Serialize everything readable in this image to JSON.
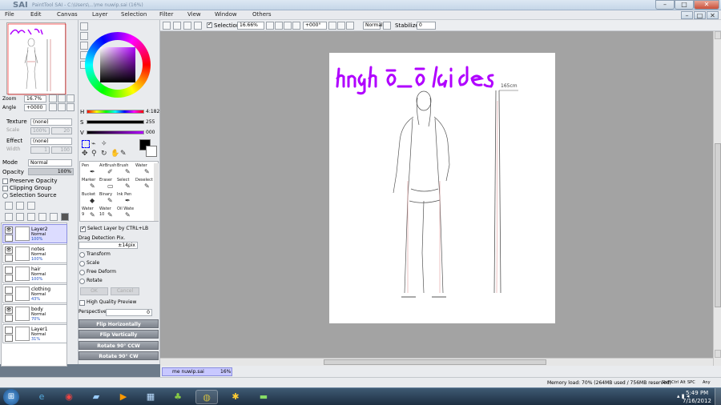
{
  "window": {
    "app_logo": "SAI",
    "title_path": "PaintTool SAI - C:\\Users\\...\\me nuwip.sai (16%)"
  },
  "menu": [
    "File",
    "Edit",
    "Canvas",
    "Layer",
    "Selection",
    "Filter",
    "View",
    "Window",
    "Others"
  ],
  "toolbar": {
    "selection_label": "Selection",
    "zoom_value": "16.66%",
    "angle_value": "+000°",
    "mode_value": "Normal",
    "stabilizer_label": "Stabilizer",
    "stabilizer_value": "0"
  },
  "navigator": {
    "zoom_label": "Zoom",
    "zoom_value": "16.7%",
    "angle_label": "Angle",
    "angle_value": "+0000"
  },
  "color": {
    "h_label": "H",
    "h_value": "4:182",
    "s_label": "S",
    "s_value": "255",
    "v_label": "V",
    "v_value": "000",
    "primary": "#000000",
    "accent": "#b000ff"
  },
  "texture": {
    "texture_label": "Texture",
    "texture_value": "(none)",
    "scale_label": "Scale",
    "scale_value": "100%",
    "scale_num": "20",
    "effect_label": "Effect",
    "effect_value": "(none)",
    "width_label": "Width",
    "width_value": "1",
    "width_num": "100"
  },
  "layer_props": {
    "mode_label": "Mode",
    "mode_value": "Normal",
    "opacity_label": "Opacity",
    "opacity_value": "100%",
    "preserve_opacity": "Preserve Opacity",
    "clipping_group": "Clipping Group",
    "selection_source": "Selection Source"
  },
  "layers": [
    {
      "name": "Layer2",
      "mode": "Normal",
      "opacity": "100%",
      "visible": true,
      "selected": true
    },
    {
      "name": "notes",
      "mode": "Normal",
      "opacity": "100%",
      "visible": true,
      "selected": false
    },
    {
      "name": "hair",
      "mode": "Normal",
      "opacity": "100%",
      "visible": false,
      "selected": false
    },
    {
      "name": "clothing",
      "mode": "Normal",
      "opacity": "43%",
      "visible": false,
      "selected": false
    },
    {
      "name": "body",
      "mode": "Normal",
      "opacity": "70%",
      "visible": true,
      "selected": false
    },
    {
      "name": "Layer1",
      "mode": "Normal",
      "opacity": "31%",
      "visible": false,
      "selected": false
    }
  ],
  "tools": [
    {
      "label": "Pen",
      "size": ""
    },
    {
      "label": "AirBrush",
      "size": ""
    },
    {
      "label": "Brush",
      "size": ""
    },
    {
      "label": "Water",
      "size": ""
    },
    {
      "label": "Marker",
      "size": ""
    },
    {
      "label": "Eraser",
      "size": ""
    },
    {
      "label": "Select",
      "size": ""
    },
    {
      "label": "Deselect",
      "size": ""
    },
    {
      "label": "Bucket",
      "size": ""
    },
    {
      "label": "Binary",
      "size": ""
    },
    {
      "label": "Ink Pen",
      "size": ""
    },
    {
      "label": "",
      "size": ""
    },
    {
      "label": "Water",
      "size": "9"
    },
    {
      "label": "Water",
      "size": "10"
    },
    {
      "label": "Oil Wate",
      "size": ""
    },
    {
      "label": "",
      "size": ""
    }
  ],
  "tool_options": {
    "select_by_ctrl": "Select Layer by CTRL+LB",
    "drag_detection": "Drag Detection Pix.",
    "drag_value": "±14pix",
    "transform": "Transform",
    "scale": "Scale",
    "free_deform": "Free Deform",
    "rotate": "Rotate",
    "ok": "OK",
    "cancel": "Cancel",
    "high_quality_preview": "High Quality Preview",
    "perspective_label": "Perspective",
    "perspective_value": "0",
    "flip_h": "Flip Horizontally",
    "flip_v": "Flip Vertically",
    "rot_ccw": "Rotate 90° CCW",
    "rot_cw": "Rotate 90° CW"
  },
  "canvas": {
    "doodle_text": "Hngh ô_ô ladies",
    "height_label": "165cm"
  },
  "document_tab": {
    "name": "me nuwip.sai",
    "zoom": "16%"
  },
  "status": {
    "memory": "Memory load: 70% (264MB used / 756MB reserved)",
    "keys": [
      "Shift",
      "Ctrl",
      "Alt",
      "SPC",
      "Any"
    ]
  },
  "taskbar": {
    "time": "5:49 PM",
    "date": "7/16/2012"
  }
}
